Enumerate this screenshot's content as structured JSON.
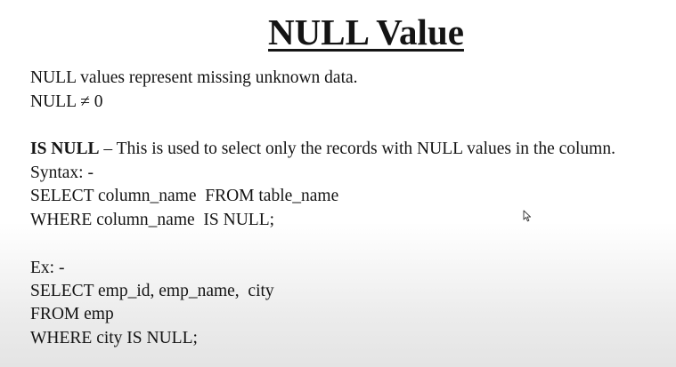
{
  "slide": {
    "title": "NULL Value",
    "intro": {
      "line1": "NULL values represent missing unknown data.",
      "line2": "NULL ≠ 0"
    },
    "is_null": {
      "term": "IS NULL",
      "description": " – This is used to select only the records with NULL values in the column.",
      "syntax_label": "Syntax: -",
      "syntax_line1": "SELECT column_name  FROM table_name",
      "syntax_line2": "WHERE column_name  IS NULL;"
    },
    "example": {
      "label": "Ex: -",
      "line1": "SELECT emp_id, emp_name,  city",
      "line2": "FROM emp",
      "line3": "WHERE city IS NULL;"
    }
  },
  "cursor": {
    "icon": "mouse-pointer-icon"
  }
}
